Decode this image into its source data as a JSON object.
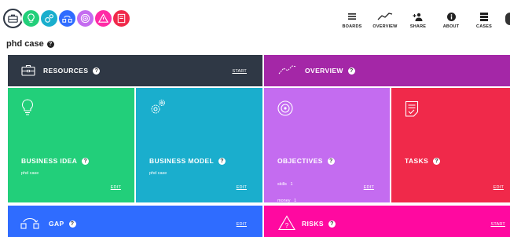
{
  "header": {
    "logo_icons": [
      {
        "icon": "briefcase-icon",
        "color": "#ffffff",
        "border": "#2f3845"
      },
      {
        "icon": "lightbulb-icon",
        "color": "#22cf7a"
      },
      {
        "icon": "gears-icon",
        "color": "#1aaecd"
      },
      {
        "icon": "gap-icon",
        "color": "#2f6cff"
      },
      {
        "icon": "target-icon",
        "color": "#c46cf0"
      },
      {
        "icon": "warning-icon",
        "color": "#ff2aa5"
      },
      {
        "icon": "tasks-icon",
        "color": "#f0294a"
      }
    ],
    "nav": [
      {
        "label": "BOARDS",
        "icon": "boards-icon"
      },
      {
        "label": "OVERVIEW",
        "icon": "overview-icon"
      },
      {
        "label": "SHARE",
        "icon": "share-icon"
      },
      {
        "label": "ABOUT",
        "icon": "about-icon"
      },
      {
        "label": "CASES",
        "icon": "cases-icon"
      }
    ]
  },
  "page": {
    "title": "phd case"
  },
  "resources": {
    "title": "RESOURCES",
    "action": "START",
    "color": "#2f3845"
  },
  "overview": {
    "title": "OVERVIEW",
    "color": "#a427a7"
  },
  "cards": {
    "business_idea": {
      "title": "BUSINESS IDEA",
      "text": "phd case",
      "action": "EDIT",
      "color": "#22cf7a"
    },
    "business_model": {
      "title": "BUSINESS MODEL",
      "text": "phd case",
      "action": "EDIT",
      "color": "#1aaecd"
    },
    "objectives": {
      "title": "OBJECTIVES",
      "lines": [
        "skills   1",
        "money   1"
      ],
      "action": "EDIT",
      "color": "#c46cf0"
    },
    "tasks": {
      "title": "TASKS",
      "action": "EDIT",
      "color": "#f0294a"
    }
  },
  "gap": {
    "title": "GAP",
    "action": "EDIT",
    "color": "#2f6cff"
  },
  "risks": {
    "title": "RISKS",
    "action": "START",
    "color": "#ff09a0"
  }
}
